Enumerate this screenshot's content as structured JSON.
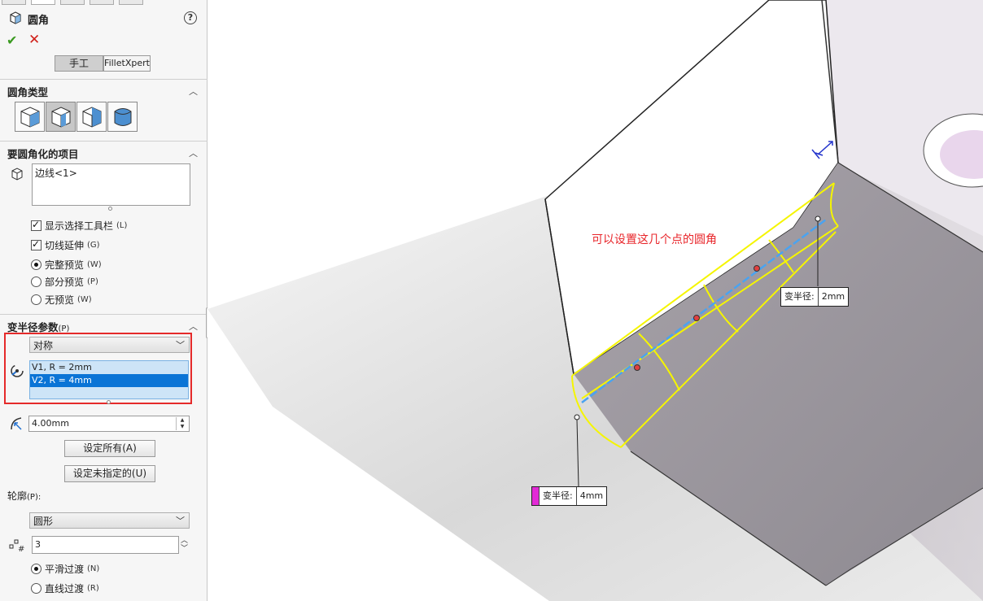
{
  "panel": {
    "title": "圆角",
    "help": "?",
    "mode_tabs": [
      "手工",
      "FilletXpert"
    ],
    "sections": {
      "fillet_type": {
        "title": "圆角类型"
      },
      "items": {
        "title": "要圆角化的项目",
        "list_value": "边线<1>",
        "options": [
          {
            "label": "显示选择工具栏",
            "hotkey": "(L)",
            "checked": true
          },
          {
            "label": "切线延伸",
            "hotkey": "(G)",
            "checked": true
          }
        ],
        "preview": [
          {
            "label": "完整预览",
            "hotkey": "(W)",
            "selected": true
          },
          {
            "label": "部分预览",
            "hotkey": "(P)",
            "selected": false
          },
          {
            "label": "无预览",
            "hotkey": "(W)",
            "selected": false
          }
        ]
      },
      "variable_radius": {
        "title": "变半径参数",
        "hotkey": "(P)",
        "symmetry_select": "对称",
        "vertices": [
          "V1, R = 2mm",
          "V2, R = 4mm"
        ],
        "selected_vertex": 1,
        "radius_value": "4.00mm",
        "set_all_button": "设定所有(A)",
        "set_unassigned_button": "设定未指定的(U)",
        "profile_label": "轮廓",
        "profile_hotkey": "(P):",
        "profile_select": "圆形",
        "instances": "3",
        "transition": [
          {
            "label": "平滑过渡",
            "hotkey": "(N)",
            "selected": true
          },
          {
            "label": "直线过渡",
            "hotkey": "(R)",
            "selected": false
          }
        ]
      }
    }
  },
  "viewport": {
    "annotation": "可以设置这几个点的圆角",
    "callout_top": {
      "label": "变半径:",
      "value": "2mm"
    },
    "callout_bottom": {
      "label": "变半径:",
      "value": "4mm"
    }
  },
  "colors": {
    "accent_blue": "#0a74d6",
    "highlight_red": "#e52a2a",
    "preview_yellow": "#f5f500",
    "edge_blue": "#4aa3f0",
    "face_light": "#f2eff3",
    "face_dark": "#9f9aa1"
  }
}
